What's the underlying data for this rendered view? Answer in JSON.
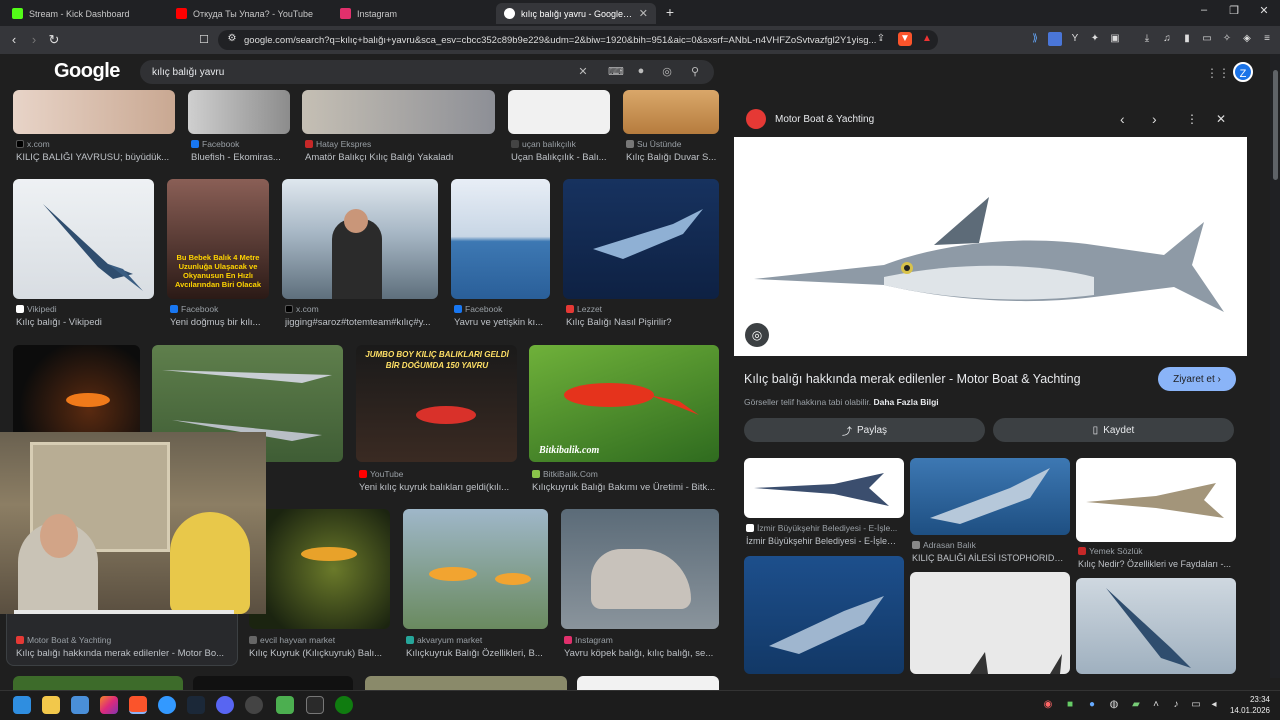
{
  "tabs": [
    {
      "label": "Stream - Kick Dashboard",
      "icon": "kick-icon",
      "color": "#53fc18"
    },
    {
      "label": "Откуда Ты Упала? - YouTube",
      "icon": "youtube-icon",
      "color": "#ff0000"
    },
    {
      "label": "Instagram",
      "icon": "instagram-icon",
      "color": "#e1306c"
    },
    {
      "label": "kılıç balığı yavru - Google'da Ara",
      "icon": "google-icon",
      "color": "#4285f4"
    }
  ],
  "new_tab": "+",
  "window": {
    "minimize": "–",
    "restore": "❐",
    "close": "✕"
  },
  "url": "google.com/search?q=kılıç+balığı+yavru&sca_esv=cbcc352c89b9e229&udm=2&biw=1920&bih=951&aic=0&sxsrf=ANbL-n4VHFZoSvtvazfgl2Y1yisg...",
  "google": {
    "logo": "Google",
    "query": "kılıç balığı yavru"
  },
  "row1": [
    {
      "source": "x.com",
      "caption": "KILIÇ BALIĞI YAVRUSU; büyüdük..."
    },
    {
      "source": "Facebook",
      "caption": "Bluefish - Ekomiras..."
    },
    {
      "source": "Hatay Ekspres",
      "caption": "Amatör Balıkçı Kılıç Balığı Yakaladı"
    },
    {
      "source": "uçan balıkçılık",
      "caption": "Uçan Balıkçılık - Balı..."
    },
    {
      "source": "Su Üstünde",
      "caption": "Kılıç Balığı Duvar S..."
    }
  ],
  "row2": [
    {
      "source": "Vikipedi",
      "caption": "Kılıç balığı - Vikipedi"
    },
    {
      "source": "Facebook",
      "caption": "Yeni doğmuş bir kılı...",
      "overlay": "Bu Bebek Balık 4 Metre Uzunluğa Ulaşacak ve Okyanusun En Hızlı Avcılarından Biri Olacak"
    },
    {
      "source": "x.com",
      "caption": "jigging#saroz#totemteam#kılıç#y..."
    },
    {
      "source": "Facebook",
      "caption": "Yavru ve yetişkin kı..."
    },
    {
      "source": "Lezzet",
      "caption": "Kılıç Balığı Nasıl Pişirilir?"
    }
  ],
  "row3": [
    {
      "source": "YouTube",
      "caption": "Yeni kılıç kuyruk balıkları geldi(kılı...",
      "overlay": "JUMBO BOY KILIÇ BALIKLARI GELDİ BİR DOĞUMDA 150 YAVRU"
    },
    {
      "source": "BitkiBalik.Com",
      "caption": "Kılıçkuyruk Balığı Bakımı ve Üretimi - Bitk...",
      "overlay": "Bitkibalik.com"
    }
  ],
  "row4": [
    {
      "source": "Motor Boat & Yachting",
      "caption": "Kılıç balığı hakkında merak edilenler - Motor Bo..."
    },
    {
      "source": "evcil hayvan market",
      "caption": "Kılıç Kuyruk (Kılıçkuyruk) Balı..."
    },
    {
      "source": "akvaryum market",
      "caption": "Kılıçkuyruk Balığı Özellikleri, B..."
    },
    {
      "source": "Instagram",
      "caption": "Yavru köpek balığı, kılıç balığı, se..."
    }
  ],
  "panel": {
    "source": "Motor Boat & Yachting",
    "title": "Kılıç balığı hakkında merak edilenler - Motor Boat & Yachting",
    "visit": "Ziyaret et",
    "copyright": "Görseller telif hakkına tabi olabilir.",
    "more_info": "Daha Fazla Bilgi",
    "share": "Paylaş",
    "save": "Kaydet",
    "related": [
      {
        "source": "İzmir Büyükşehir Belediyesi - E-İşle...",
        "caption": "İzmir Büyükşehir Belediyesi - E-İşlem..."
      },
      {
        "source": "Adrasan Balık",
        "caption": "KILIÇ BALIĞI AİLESİ ISTOPHORIDAE -..."
      },
      {
        "source": "Yemek Sözlük",
        "caption": "Kılıç Nedir? Özellikleri ve Faydaları -..."
      }
    ]
  },
  "clock": {
    "time": "23:34",
    "date": "14.01.2026"
  }
}
